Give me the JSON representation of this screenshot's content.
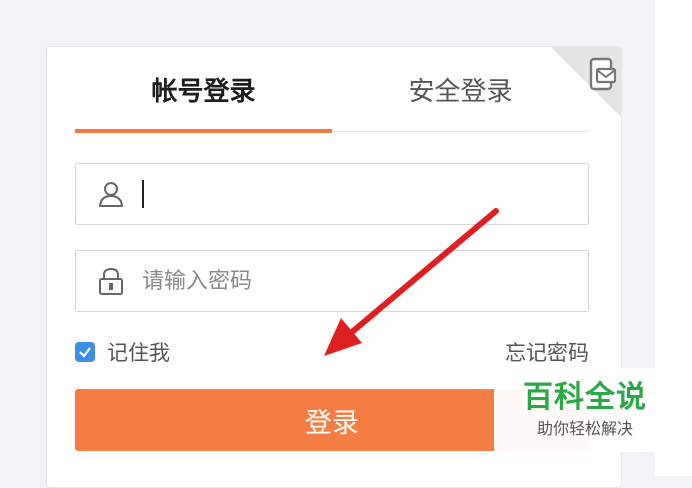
{
  "tabs": [
    {
      "label": "帐号登录",
      "active": true
    },
    {
      "label": "安全登录",
      "active": false
    }
  ],
  "username": {
    "value": "",
    "icon": "user-icon"
  },
  "password": {
    "placeholder": "请输入密码",
    "icon": "lock-icon"
  },
  "remember": {
    "label": "记住我",
    "checked": true
  },
  "forgot_label": "忘记密码",
  "login_label": "登录",
  "corner_icon": "device-switch-icon",
  "watermark": {
    "title": "百科全说",
    "subtitle": "助你轻松解决"
  },
  "colors": {
    "accent": "#f47d44",
    "tab_underline": "#f07a3f",
    "checkbox": "#3a8fe8",
    "arrow": "#e02020",
    "watermark_green": "#2aa845"
  }
}
